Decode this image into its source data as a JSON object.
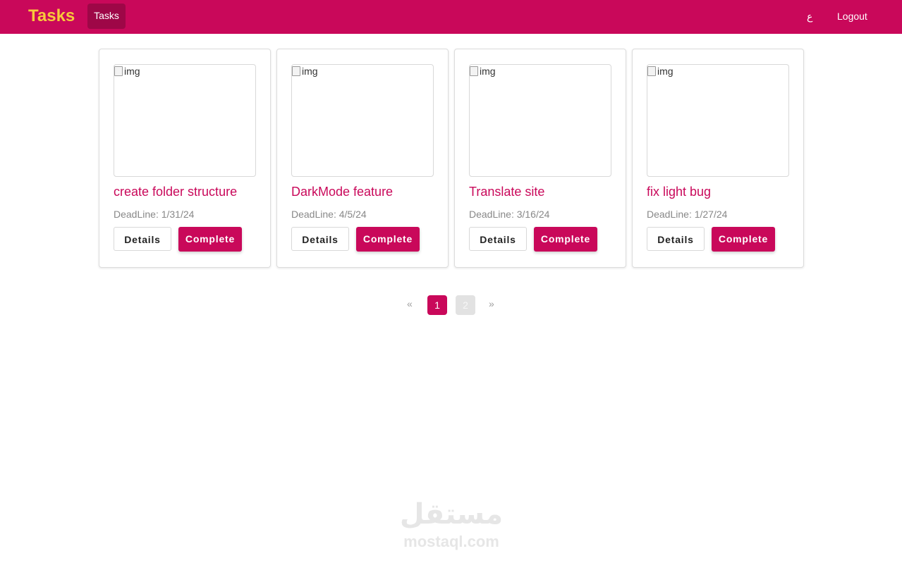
{
  "navbar": {
    "brand": "Tasks",
    "tasks_link": "Tasks",
    "lang_toggle": "ع",
    "logout": "Logout",
    "color": "#c9085a",
    "brand_color": "#f7c93a"
  },
  "cards": [
    {
      "img_alt": "img",
      "title": "create folder structure",
      "deadline": "DeadLine: 1/31/24",
      "details_label": "Details",
      "complete_label": "Complete"
    },
    {
      "img_alt": "img",
      "title": "DarkMode feature",
      "deadline": "DeadLine: 4/5/24",
      "details_label": "Details",
      "complete_label": "Complete"
    },
    {
      "img_alt": "img",
      "title": "Translate site",
      "deadline": "DeadLine: 3/16/24",
      "details_label": "Details",
      "complete_label": "Complete"
    },
    {
      "img_alt": "img",
      "title": "fix light bug",
      "deadline": "DeadLine: 1/27/24",
      "details_label": "Details",
      "complete_label": "Complete"
    }
  ],
  "pagination": {
    "prev": "«",
    "pages": [
      "1",
      "2"
    ],
    "current": "1",
    "next": "»"
  },
  "watermark": {
    "arabic": "مستقل",
    "latin": "mostaql.com"
  }
}
